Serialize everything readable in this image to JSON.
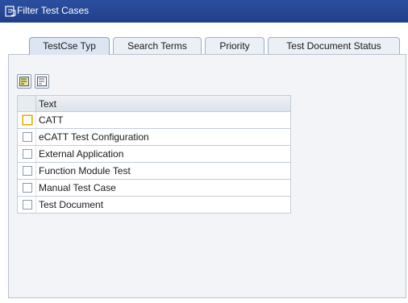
{
  "window": {
    "title": "Filter Test Cases"
  },
  "tabs": [
    {
      "label": "TestCse Typ",
      "active": true
    },
    {
      "label": "Search Terms",
      "active": false
    },
    {
      "label": "Priority",
      "active": false
    },
    {
      "label": "Test Document Status",
      "active": false
    }
  ],
  "toolbar": {
    "buttons": [
      {
        "icon": "select-all-icon"
      },
      {
        "icon": "deselect-all-icon"
      }
    ]
  },
  "table": {
    "column_header": "Text",
    "rows": [
      {
        "text": "CATT"
      },
      {
        "text": "eCATT Test Configuration"
      },
      {
        "text": "External Application"
      },
      {
        "text": "Function Module Test"
      },
      {
        "text": "Manual Test Case"
      },
      {
        "text": "Test Document"
      }
    ]
  },
  "colors": {
    "titlebar": "#203f8a",
    "panel": "#f2f4f7",
    "checkbox_focus": "#e0b000"
  }
}
